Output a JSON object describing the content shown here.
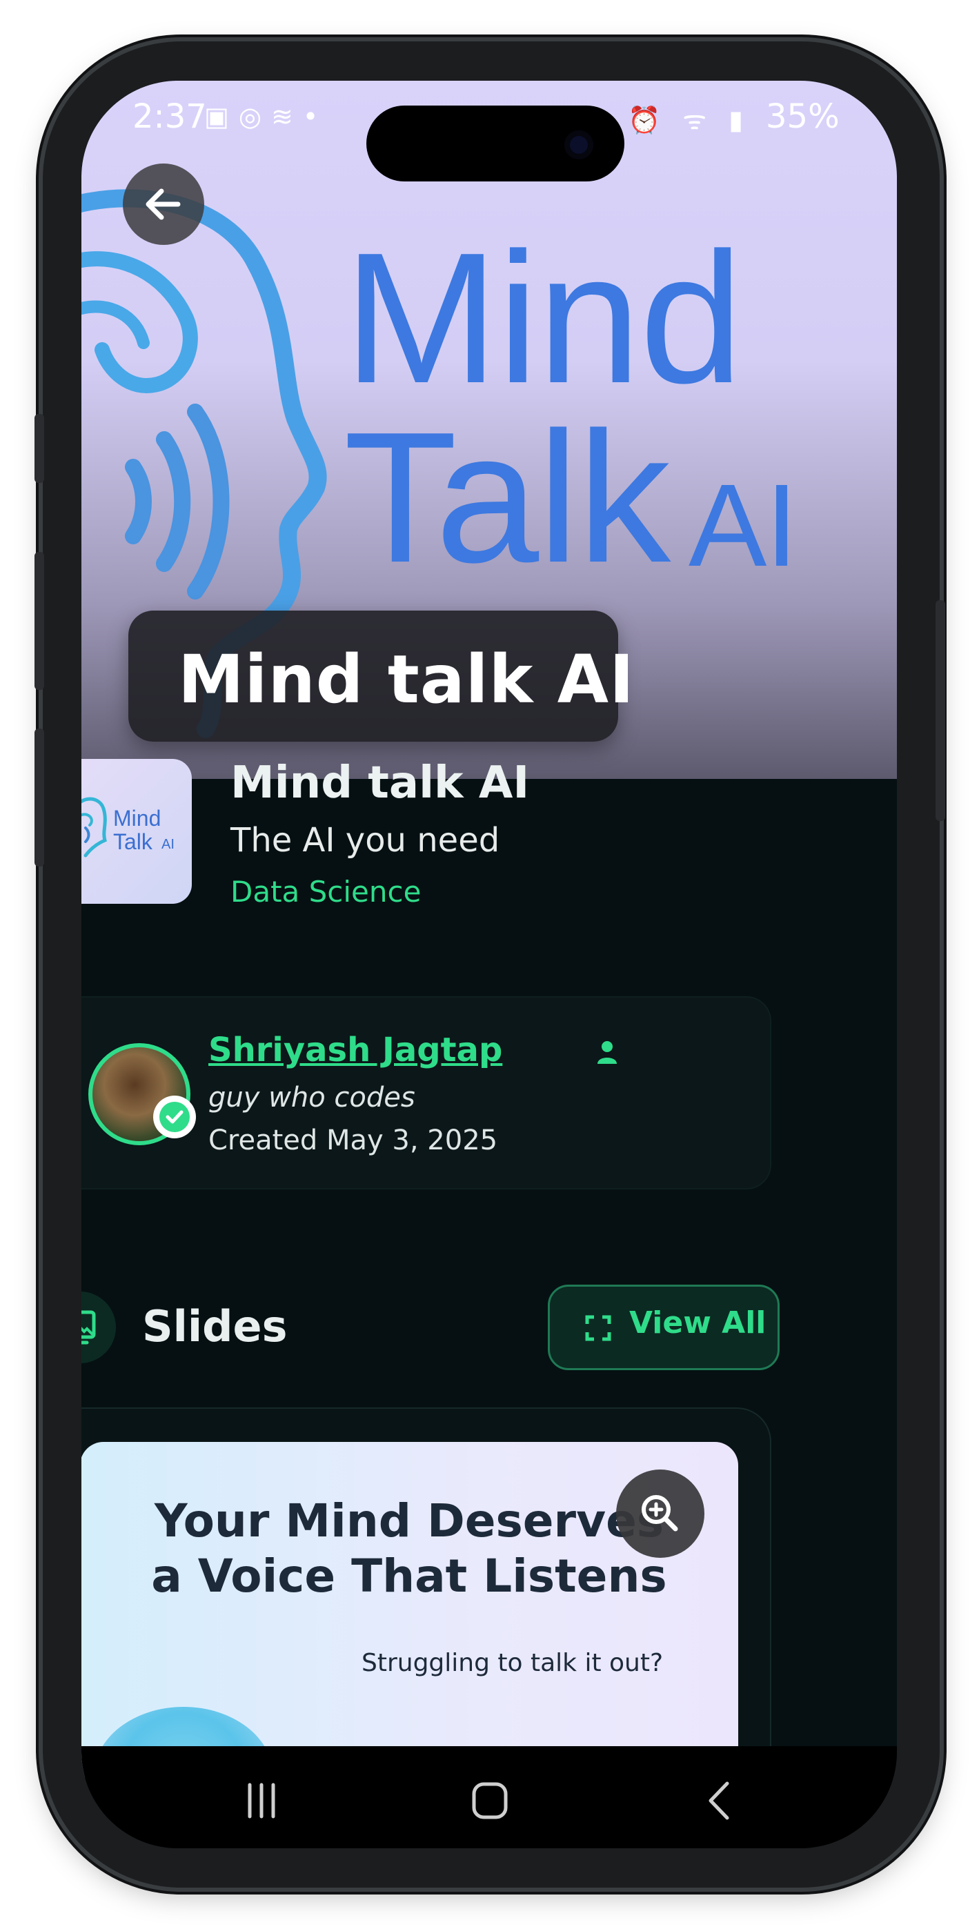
{
  "status_bar": {
    "time": "2:37",
    "battery": "35%"
  },
  "hero": {
    "logo_line1": "Mind",
    "logo_line2": "Talk",
    "logo_suffix": "AI",
    "title": "Mind talk AI"
  },
  "app": {
    "icon_line1": "Mind",
    "icon_line2": "Talk",
    "icon_suffix": "AI",
    "name": "Mind talk AI",
    "tagline": "The AI you need",
    "category": "Data Science"
  },
  "author": {
    "name": "Shriyash Jagtap",
    "bio": "guy who codes",
    "created": "Created May 3, 2025"
  },
  "slides_section": {
    "title": "Slides",
    "view_all_label": "View All"
  },
  "slide_preview": {
    "heading_line1": "Your Mind Deserves",
    "heading_line2": "a Voice That Listens",
    "subtext": "Struggling to talk it out?"
  },
  "colors": {
    "accent": "#2fdc8a",
    "background": "#061012",
    "logo_blue": "#3d79e0"
  },
  "icons": {
    "back": "arrow-left-icon",
    "author_badge": "person-icon",
    "verified": "check-circle-icon",
    "slides": "image-gallery-icon",
    "view_all": "expand-icon",
    "zoom": "zoom-in-icon",
    "nav_recents": "recents-icon",
    "nav_home": "home-icon",
    "nav_back": "chevron-left-icon"
  }
}
